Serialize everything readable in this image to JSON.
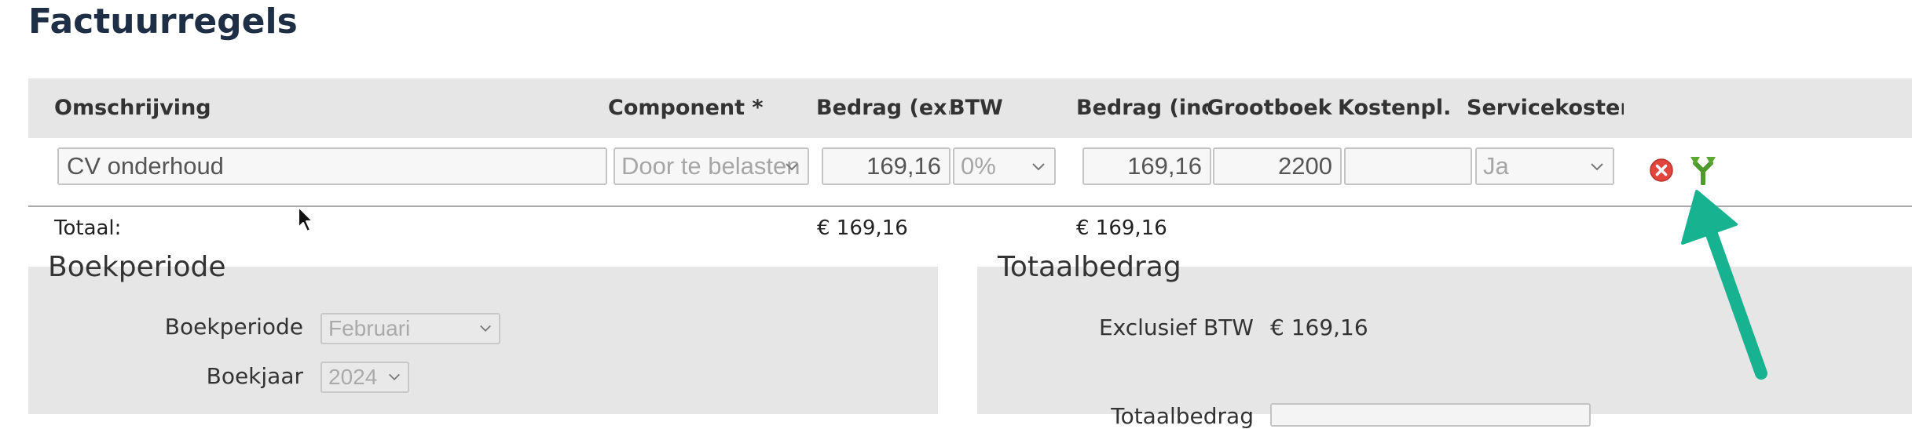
{
  "page": {
    "title": "Factuurregels"
  },
  "table": {
    "columns": [
      "Omschrijving",
      "Component *",
      "Bedrag (ex....",
      "BTW",
      "Bedrag (inc...",
      "Grootboek",
      "Kostenpl.",
      "Servicekosten"
    ],
    "row": {
      "omschrijving": "CV onderhoud",
      "component": "Door te belasten",
      "bedrag_ex": "169,16",
      "btw": "0%",
      "bedrag_inc": "169,16",
      "grootboek": "2200",
      "kostenplaats": "",
      "servicekosten": "Ja"
    },
    "totals": {
      "label": "Totaal:",
      "bedrag_ex": "€ 169,16",
      "bedrag_inc": "€ 169,16"
    }
  },
  "row_icons": {
    "delete": "delete-icon",
    "split": "split-icon"
  },
  "boekperiode": {
    "title": "Boekperiode",
    "periode_label": "Boekperiode",
    "periode_value": "Februari",
    "jaar_label": "Boekjaar",
    "jaar_value": "2024"
  },
  "totaalbedrag": {
    "title": "Totaalbedrag",
    "excl_label": "Exclusief BTW",
    "excl_value": "€ 169,16",
    "totaal_label": "Totaalbedrag"
  },
  "colors": {
    "title": "#1e2f45",
    "panel_bg": "#e6e6e6",
    "delete_icon": "#e2453c",
    "split_icon": "#5aa832",
    "arrow": "#17b290"
  }
}
